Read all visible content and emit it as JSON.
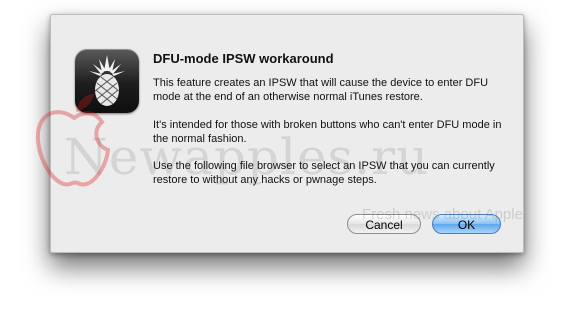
{
  "dialog": {
    "title": "DFU-mode IPSW workaround",
    "paragraphs": [
      "This feature creates an IPSW that will cause the device to enter DFU mode at the end of an otherwise normal iTunes restore.",
      "It's intended for those with broken buttons who can't enter DFU mode in the normal fashion.",
      "Use the following file browser to select an IPSW that you can currently restore to without any hacks or pwnage steps."
    ],
    "icon": "pineapple-app-icon",
    "buttons": {
      "cancel_label": "Cancel",
      "ok_label": "OK"
    }
  },
  "watermark": {
    "text": "Newapples.ru",
    "tagline": "Fresh news about Apple",
    "accent_color": "#e02020"
  }
}
